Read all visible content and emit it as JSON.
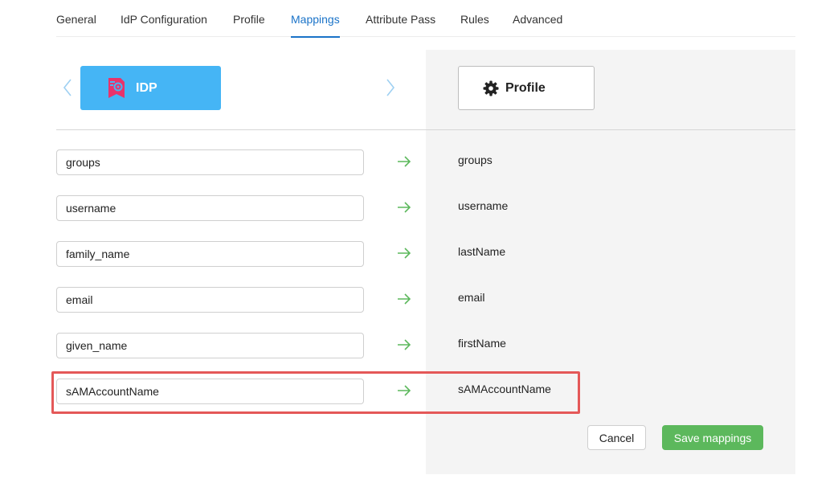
{
  "tabs": [
    {
      "label": "General"
    },
    {
      "label": "IdP Configuration"
    },
    {
      "label": "Profile"
    },
    {
      "label": "Mappings",
      "active": true
    },
    {
      "label": "Attribute Pass"
    },
    {
      "label": "Rules"
    },
    {
      "label": "Advanced"
    }
  ],
  "header": {
    "source_label": "IDP",
    "target_label": "Profile",
    "source_icon": "idp-badge-icon",
    "target_icon": "gear-icon",
    "accent_color": "#45b5f5"
  },
  "mappings": [
    {
      "source": "groups",
      "target": "groups"
    },
    {
      "source": "username",
      "target": "username"
    },
    {
      "source": "family_name",
      "target": "lastName"
    },
    {
      "source": "email",
      "target": "email"
    },
    {
      "source": "given_name",
      "target": "firstName"
    },
    {
      "source": "sAMAccountName",
      "target": "sAMAccountName",
      "highlighted": true
    }
  ],
  "actions": {
    "cancel_label": "Cancel",
    "save_label": "Save mappings",
    "save_color": "#5cb85c"
  }
}
